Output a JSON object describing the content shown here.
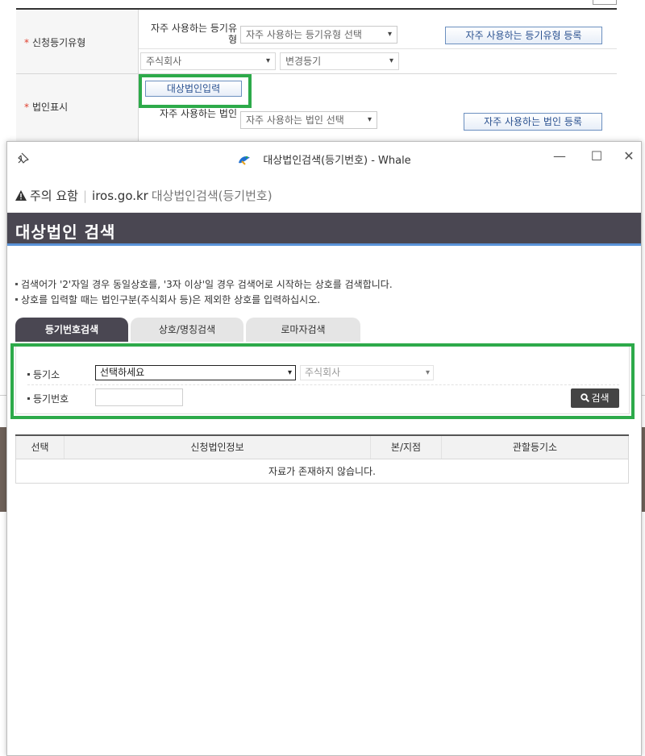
{
  "background_form": {
    "row1": {
      "label": "신청등기유형",
      "frequent_label": "자주 사용하는 등기유형",
      "frequent_select": "자주 사용하는 등기유형 선택",
      "register_button": "자주 사용하는 등기유형 등록",
      "corp_type_select": "주식회사",
      "reg_type_select": "변경등기"
    },
    "row2": {
      "label": "법인표시",
      "input_button": "대상법인입력",
      "frequent_label": "자주 사용하는 법인",
      "frequent_select": "자주 사용하는 법인 선택",
      "register_button": "자주 사용하는 법인 등록"
    },
    "required_mark": "*"
  },
  "popup": {
    "window_title": "대상법인검색(등기번호) - Whale",
    "controls": {
      "minimize": "—",
      "maximize": "☐",
      "close": "✕"
    },
    "address_bar": {
      "warning": "주의 요함",
      "domain": "iros.go.kr",
      "page_title": "대상법인검색(등기번호)"
    },
    "header_title": "대상법인 검색",
    "notes": [
      "검색어가 '2'자일 경우 동일상호를, '3자 이상'일 경우 검색어로 시작하는 상호를 검색합니다.",
      "상호를 입력할 때는 법인구분(주식회사 등)은 제외한 상호를 입력하십시오."
    ],
    "tabs": [
      "등기번호검색",
      "상호/명칭검색",
      "로마자검색"
    ],
    "search": {
      "office_label": "등기소",
      "office_select": "선택하세요",
      "corp_type_select": "주식회사",
      "reg_no_label": "등기번호",
      "reg_no_value": "",
      "search_button": "검색"
    },
    "table": {
      "headers": [
        "선택",
        "신청법인정보",
        "본/지점",
        "관할등기소"
      ],
      "empty_message": "자료가 존재하지 않습니다."
    }
  },
  "colors": {
    "highlight_green": "#2daa4a",
    "header_dark": "#4a4752",
    "header_accent": "#5a93d8",
    "button_blue": "#2a5190"
  }
}
